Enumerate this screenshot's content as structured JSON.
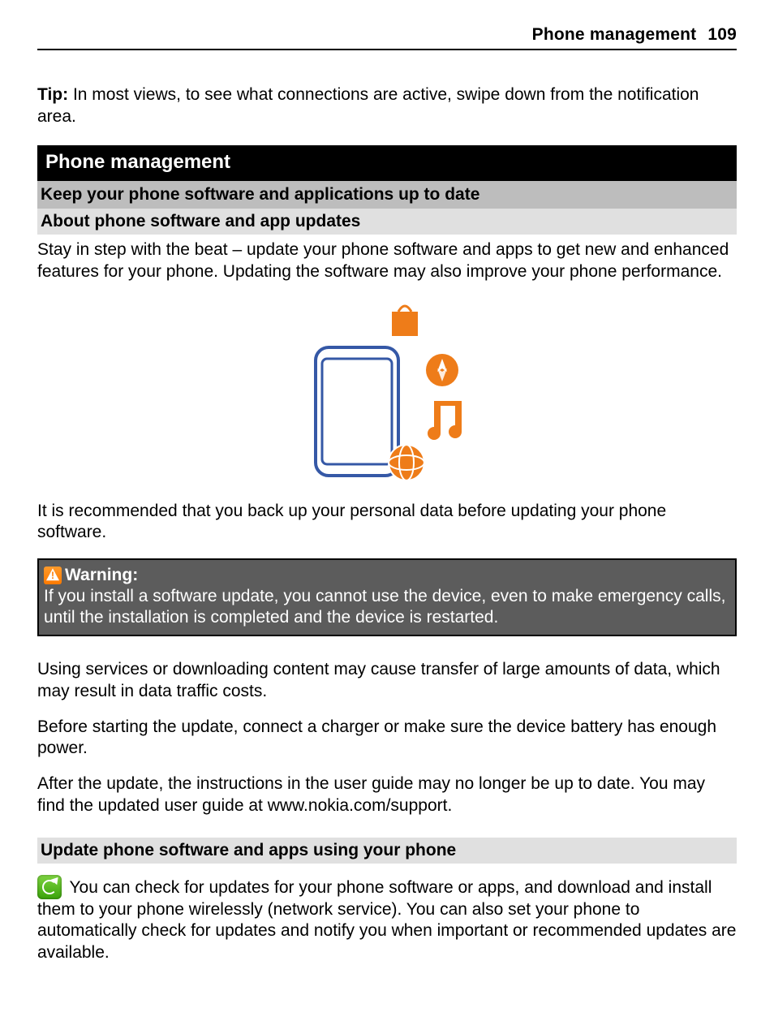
{
  "header": {
    "section": "Phone management",
    "page": "109"
  },
  "tip": {
    "label": "Tip:",
    "text": " In most views, to see what connections are active, swipe down from the notification area."
  },
  "chapter_title": "Phone management",
  "gray_heading": "Keep your phone software and applications up to date",
  "sub_heading": "About phone software and app updates",
  "para1": "Stay in step with the beat – update your phone software and apps to get new and enhanced features for your phone. Updating the software may also improve your phone performance.",
  "para_backup": "It is recommended that you back up your personal data before updating your phone software.",
  "warning": {
    "label": "Warning:",
    "text": "If you install a software update, you cannot use the device, even to make emergency calls, until the installation is completed and the device is restarted."
  },
  "para_data": "Using services or downloading content may cause transfer of large amounts of data, which may result in data traffic costs.",
  "para_charger": "Before starting the update, connect a charger or make sure the device battery has enough power.",
  "para_guide": "After the update, the instructions in the user guide may no longer be up to date. You may find the updated user guide at www.nokia.com/support.",
  "section2_heading": "Update phone software and apps using your phone",
  "para_update": " You can check for updates for your phone software or apps, and download and install them to your phone wirelessly (network service). You can also set your phone to automatically check for updates and notify you when important or recommended updates are available."
}
